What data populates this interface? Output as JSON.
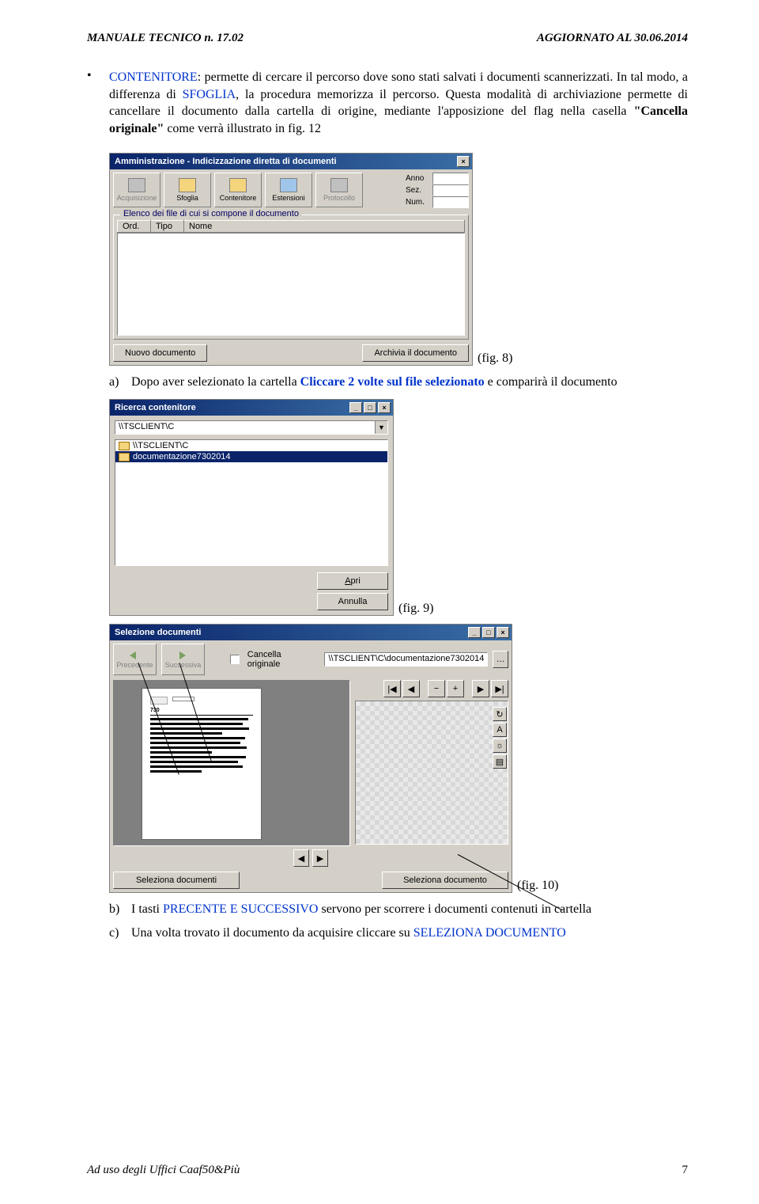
{
  "header": {
    "left": "MANUALE TECNICO n. 17.02",
    "right": "AGGIORNATO AL 30.06.2014"
  },
  "para1": {
    "contenitore": "CONTENITORE",
    "t1": ": permette di cercare il percorso dove sono stati salvati i documenti scannerizzati. In tal modo, a differenza di ",
    "sfoglia": "SFOGLIA",
    "t2": ", la procedura memorizza il percorso. Questa modalità di archiviazione permette di cancellare il documento dalla cartella di origine, mediante l'apposizione del flag nella casella ",
    "cancella": "\"Cancella originale\"",
    "t3": " come verrà illustrato in fig. 12"
  },
  "fig8": {
    "title": "Amministrazione - Indicizzazione diretta di documenti",
    "toolbar": [
      "Acquisizione",
      "Sfoglia",
      "Contenitore",
      "Estensioni",
      "Protocollo"
    ],
    "proto_labels": [
      "Anno",
      "Sez.",
      "Num."
    ],
    "group_label": "Elenco dei file di cui si compone il documento",
    "cols": [
      "Ord.",
      "Tipo",
      "Nome"
    ],
    "btn_nuovo": "Nuovo documento",
    "btn_archivia": "Archivia il documento",
    "caption": "(fig. 8)"
  },
  "item_a": {
    "letter": "a)",
    "pre": "Dopo aver selezionato la cartella ",
    "bold": "Cliccare 2 volte sul file selezionato",
    "post": " e comparirà il documento"
  },
  "fig9": {
    "title": "Ricerca contenitore",
    "combo": "\\\\TSCLIENT\\C",
    "rows": [
      "\\\\TSCLIENT\\C",
      "documentazione7302014"
    ],
    "btn_apri": "Apri",
    "btn_annulla": "Annulla",
    "caption": "(fig. 9)"
  },
  "fig10": {
    "title": "Selezione documenti",
    "nav_prev": "Precedente",
    "nav_next": "Successiva",
    "chk_label": "Cancella originale",
    "path": "\\\\TSCLIENT\\C\\documentazione7302014",
    "btn_sel_docs": "Seleziona documenti",
    "btn_sel_doc": "Seleziona documento",
    "caption": "(fig. 10)"
  },
  "item_b": {
    "letter": "b)",
    "pre": "I tasti ",
    "link": "PRECENTE E SUCCESSIVO",
    "post": " servono per scorrere i documenti contenuti in cartella"
  },
  "item_c": {
    "letter": "c)",
    "pre": "Una volta trovato il documento da acquisire cliccare su ",
    "link": "SELEZIONA DOCUMENTO"
  },
  "footer": {
    "left": "Ad uso degli Uffici Caaf50&Più",
    "page": "7"
  }
}
